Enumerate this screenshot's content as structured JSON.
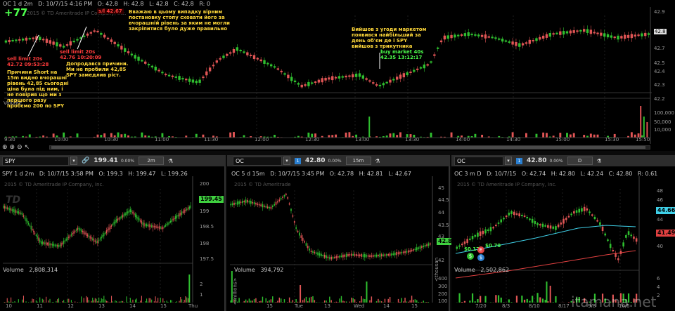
{
  "main": {
    "pl": "+77",
    "header": {
      "sym": "OC 1 d 2m",
      "date": "D: 10/7/15 4:16 PM",
      "o": "O: 42.8",
      "h": "H: 42.8",
      "l": "L: 42.8",
      "c": "C: 42.8",
      "r": "R: 0",
      "copyright": "2015 © TD Ameritrade IP Company, Inc."
    },
    "price_ticks": [
      "42.9",
      "42.8",
      "42.7",
      "42.6",
      "42.5",
      "42.4",
      "42.3",
      "42.2"
    ],
    "current_price": "42.8",
    "vol_ticks": [
      "100,000",
      "50,000",
      "10,000"
    ],
    "volume_label": "Volume",
    "time_ticks": [
      "9:30",
      "10:00",
      "10:30",
      "11:00",
      "11:30",
      "12:00",
      "12:30",
      "13:00",
      "13:30",
      "14:00",
      "14:30",
      "15:00",
      "15:30",
      "15:50"
    ],
    "annotations": {
      "sell1": [
        "sell limit 20s",
        "42.72 09:53:28"
      ],
      "sell2": [
        "sell limit 20s",
        "42.76 10:20:09"
      ],
      "reason_short": [
        "Причини Short на",
        "15m видно вчорашні",
        "рівень 42,85 сьогодні",
        "ціна була під ним,  і",
        "не повірив що ми  з",
        "першого разу",
        "пробємо 200 по SPY"
      ],
      "added": [
        "Допродався причини.",
        "Ми не пробили 42,85",
        "SPY замедлив ріст."
      ],
      "top_price": "s/l 42.67",
      "top_note": [
        "Вважаю в цьому випадку вірним",
        "постановку стопу сховати його за",
        "вчорашній рівень за яким не могли",
        "закріпитися було дуже правильно"
      ],
      "exit_note": [
        "Вийшов з угоди маркетом",
        "появився найбільший за",
        "день об'єм де і SPY",
        "вийшов з трикутника"
      ],
      "buy": [
        "buy market 40s",
        "42.35 13:12:17"
      ]
    }
  },
  "spy": {
    "symbol": "SPY",
    "price": "199.41",
    "change": "0.00%",
    "interval": "2m",
    "header": {
      "sym": "SPY 1 d 2m",
      "date": "D: 10/7/15 3:58 PM",
      "o": "O: 199.3",
      "h": "H: 199.47",
      "l": "L: 199.26",
      "c": "C: ..."
    },
    "copyright": "2015 © TD Ameritrade IP Company, Inc.",
    "price_ticks": [
      "200",
      "199.5",
      "199",
      "198.5",
      "198",
      "197.5"
    ],
    "current_tag": "199.45",
    "volume_label": "Volume",
    "volume_value": "2,808,314",
    "vol_ticks": [
      "2",
      "1"
    ],
    "time_ticks": [
      "10",
      "11",
      "12",
      "13",
      "14",
      "15",
      "Thu"
    ]
  },
  "oc15": {
    "symbol": "OC",
    "price": "42.80",
    "change": "0.00%",
    "interval": "15m",
    "header": {
      "sym": "OC 5 d 15m",
      "date": "D: 10/7/15 3:45 PM",
      "o": "O: 42.78",
      "h": "H: 42.81",
      "l": "L: 42.67"
    },
    "copyright": "2015 © TD Ameritrade",
    "price_ticks": [
      "45",
      "44.5",
      "44",
      "43.5",
      "43",
      "42.5",
      "42"
    ],
    "current_tag": "42.81",
    "volume_label": "Volume",
    "volume_value": "394,792",
    "vol_ticks": [
      "400",
      "300",
      "200",
      "100"
    ],
    "vol_unit": "<thousan",
    "left_unit": "<millions>",
    "time_ticks": [
      "15",
      "Tue",
      "13",
      "Wed",
      "14",
      "15"
    ]
  },
  "oc3m": {
    "symbol": "OC",
    "price": "42.80",
    "change": "0.00%",
    "interval": "D",
    "header": {
      "sym": "OC 3 m D",
      "date": "D: 10/7/15",
      "o": "O: 42.74",
      "h": "H: 42.80",
      "l": "L: 42.24",
      "c": "C: 42.80",
      "r": "R: 0.61"
    },
    "copyright": "2015 © TD Ameritrade IP Company, Inc.",
    "price_ticks": [
      "48",
      "46",
      "44",
      "42",
      "40"
    ],
    "tag_cyan": "44.66",
    "tag_red": "41.49",
    "div1": "$0.17",
    "div2": "$0.70",
    "volume_label": "Volume",
    "volume_value": "2,502,862",
    "vol_ticks": [
      "6",
      "4",
      "2"
    ],
    "time_ticks": [
      "7/20",
      "8/3",
      "8/10",
      "8/17",
      "9/8",
      "10/5"
    ]
  },
  "watermark": "itamana.net",
  "colors": {
    "up": "#2fbf2f",
    "down": "#e05555",
    "accent_cyan": "#3fd0e8",
    "accent_red": "#e04040"
  }
}
